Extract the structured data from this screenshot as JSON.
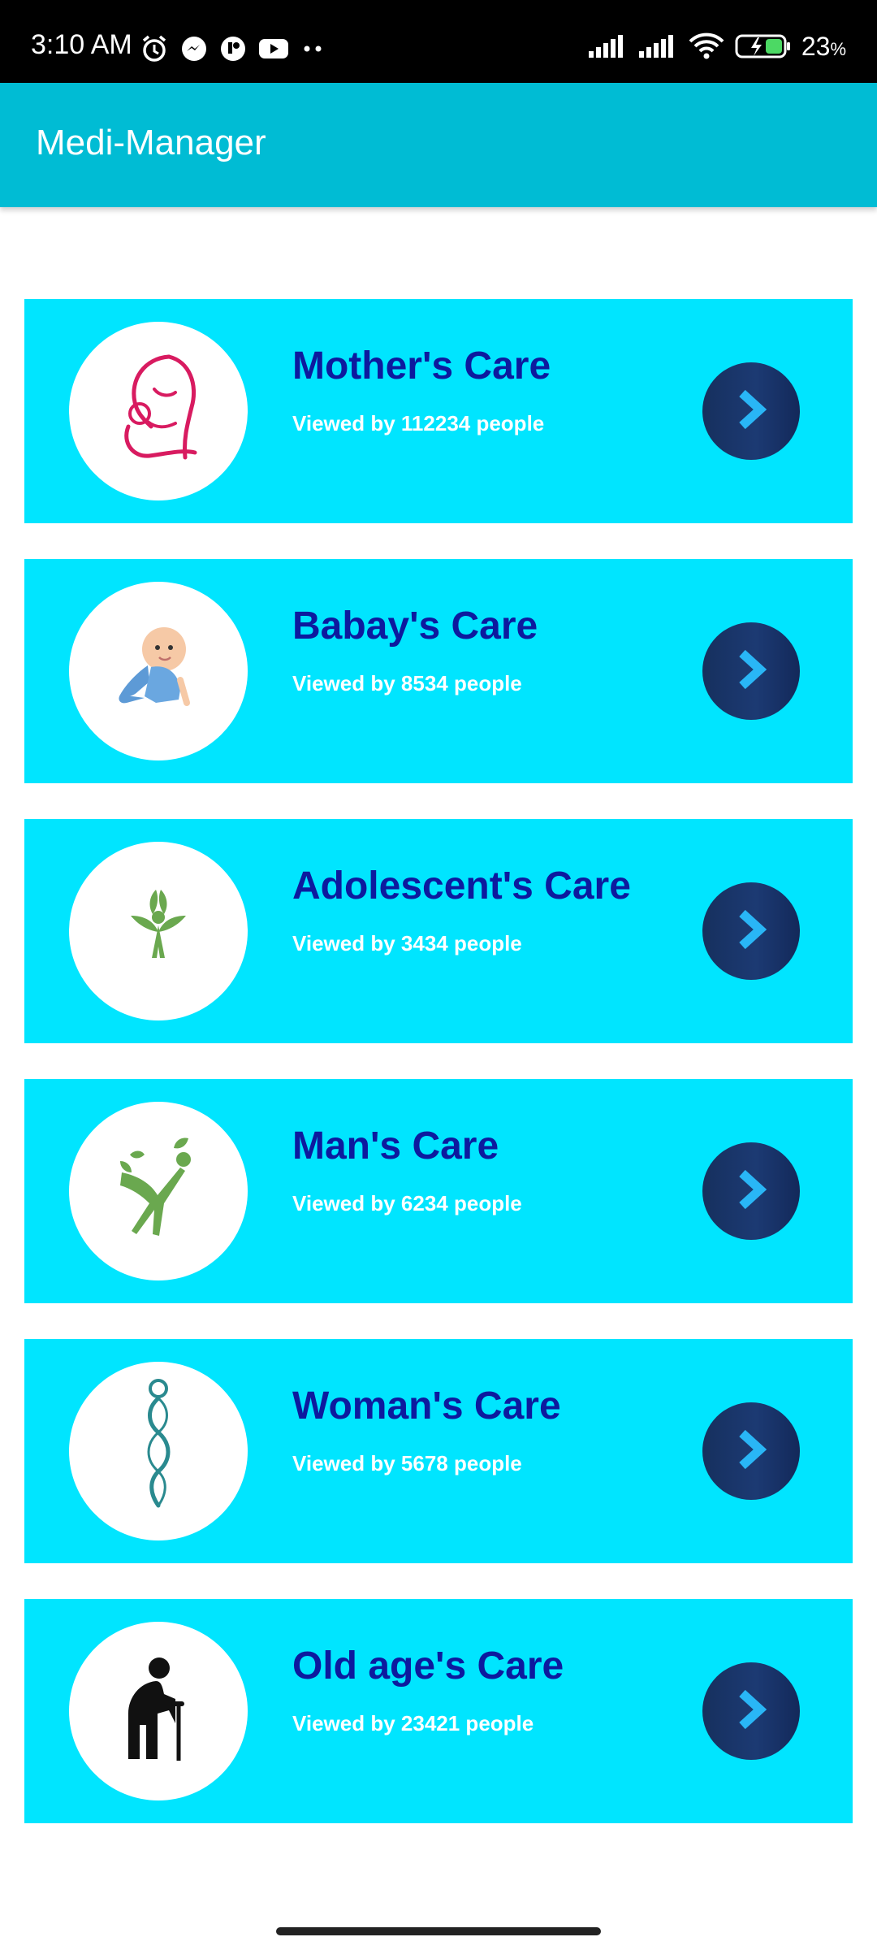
{
  "status_bar": {
    "time": "3:10 AM",
    "battery": "23",
    "battery_unit": "%",
    "left_icons": [
      "alarm-icon",
      "messenger-icon",
      "app-icon",
      "youtube-icon",
      "more-dots-icon"
    ],
    "right_icons": [
      "signal-icon",
      "signal-icon",
      "wifi-icon",
      "battery-charging-icon"
    ]
  },
  "app_bar": {
    "title": "Medi-Manager",
    "color": "#00bcd4"
  },
  "cards": [
    {
      "title": "Mother's Care",
      "subtitle": "Viewed by 112234 people",
      "icon": "mother-child-icon"
    },
    {
      "title": "Babay's Care",
      "subtitle": "Viewed by 8534 people",
      "icon": "baby-icon"
    },
    {
      "title": "Adolescent's Care",
      "subtitle": "Viewed by 3434 people",
      "icon": "sprout-person-icon"
    },
    {
      "title": "Man's Care",
      "subtitle": "Viewed by 6234 people",
      "icon": "leaf-man-icon"
    },
    {
      "title": "Woman's Care",
      "subtitle": "Viewed by 5678 people",
      "icon": "woman-silhouette-icon"
    },
    {
      "title": "Old age's Care",
      "subtitle": "Viewed by 23421 people",
      "icon": "elderly-person-icon"
    }
  ],
  "colors": {
    "card_background": "#00e5ff",
    "title_text": "#0d1a9e",
    "subtitle_text": "#ffffff",
    "arrow_button": "#1c3a73",
    "arrow_chevron": "#29b6f6"
  }
}
